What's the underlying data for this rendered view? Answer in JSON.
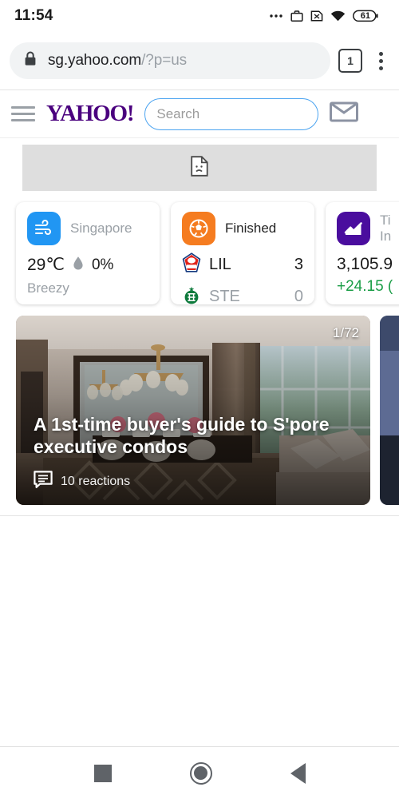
{
  "status_bar": {
    "time": "11:54",
    "battery_level": "61",
    "icons": [
      "ellipsis-icon",
      "work-briefcase-icon",
      "no-sim-icon",
      "wifi-icon",
      "battery-icon"
    ]
  },
  "browser": {
    "url_host": "sg.yahoo.com",
    "url_path": "/?p=us",
    "lock_icon": "lock-icon",
    "tab_count": "1",
    "menu_icon": "kebab-menu-icon"
  },
  "site_header": {
    "logo_text": "YAHOO!",
    "logo_color": "#4a007e",
    "menu_icon": "hamburger-icon",
    "search_placeholder": "Search",
    "search_value": "",
    "search_button_icon": "search-icon",
    "search_accent": "#2196f3",
    "mail_icon": "mail-envelope-icon"
  },
  "banner": {
    "placeholder_icon": "broken-image-icon"
  },
  "cards": {
    "weather": {
      "icon": "wind-icon",
      "icon_color": "#2196f3",
      "location": "Singapore",
      "temperature": "29℃",
      "precipitation": "0%",
      "precip_icon": "water-drop-icon",
      "condition": "Breezy"
    },
    "sports": {
      "icon": "soccer-ball-icon",
      "icon_color": "#f57c20",
      "status": "Finished",
      "teams": [
        {
          "abbr": "LIL",
          "score": "3",
          "logo": "lille-crest-icon"
        },
        {
          "abbr": "STE",
          "score": "0",
          "logo": "saint-etienne-crest-icon"
        }
      ]
    },
    "finance": {
      "icon": "line-chart-icon",
      "icon_color": "#4a0d9e",
      "name_line1": "Ti",
      "name_line2": "In",
      "value": "3,105.9",
      "change": "+24.15 (",
      "change_color": "#1a9d46"
    }
  },
  "article": {
    "counter": "1/72",
    "title": "A 1st-time buyer's guide to S'pore executive condos",
    "reactions_count": "10 reactions",
    "reactions_icon": "comment-bubble-icon"
  },
  "nav_bar": {
    "recents_icon": "square-recents-icon",
    "home_icon": "circle-home-icon",
    "back_icon": "triangle-back-icon"
  }
}
